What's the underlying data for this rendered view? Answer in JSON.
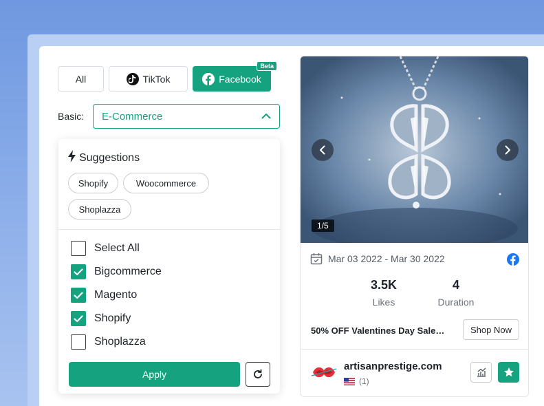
{
  "filters": {
    "tabs": [
      {
        "label": "All"
      },
      {
        "label": "TikTok"
      },
      {
        "label": "Facebook",
        "badge": "Beta"
      }
    ],
    "active_tab": "Facebook"
  },
  "basic": {
    "label": "Basic:",
    "selected": "E-Commerce"
  },
  "dropdown": {
    "suggestions_title": "Suggestions",
    "suggestions": [
      "Shopify",
      "Woocommerce",
      "Shoplazza"
    ],
    "options": [
      {
        "label": "Select All",
        "checked": false
      },
      {
        "label": "Bigcommerce",
        "checked": true
      },
      {
        "label": "Magento",
        "checked": true
      },
      {
        "label": "Shopify",
        "checked": true
      },
      {
        "label": "Shoplazza",
        "checked": false
      }
    ],
    "apply_label": "Apply"
  },
  "ad_card": {
    "image_counter": "1/5",
    "date_range": "Mar 03 2022 - Mar 30 2022",
    "stats": [
      {
        "value": "3.5K",
        "label": "Likes"
      },
      {
        "value": "4",
        "label": "Duration"
      }
    ],
    "headline": "50% OFF Valentines Day Sale…",
    "cta_label": "Shop Now",
    "advertiser": {
      "name": "artisanprestige.com",
      "country_count": "(1)"
    }
  },
  "colors": {
    "accent": "#14a27f",
    "facebook": "#1877f2",
    "background": "#7fa3e6"
  }
}
